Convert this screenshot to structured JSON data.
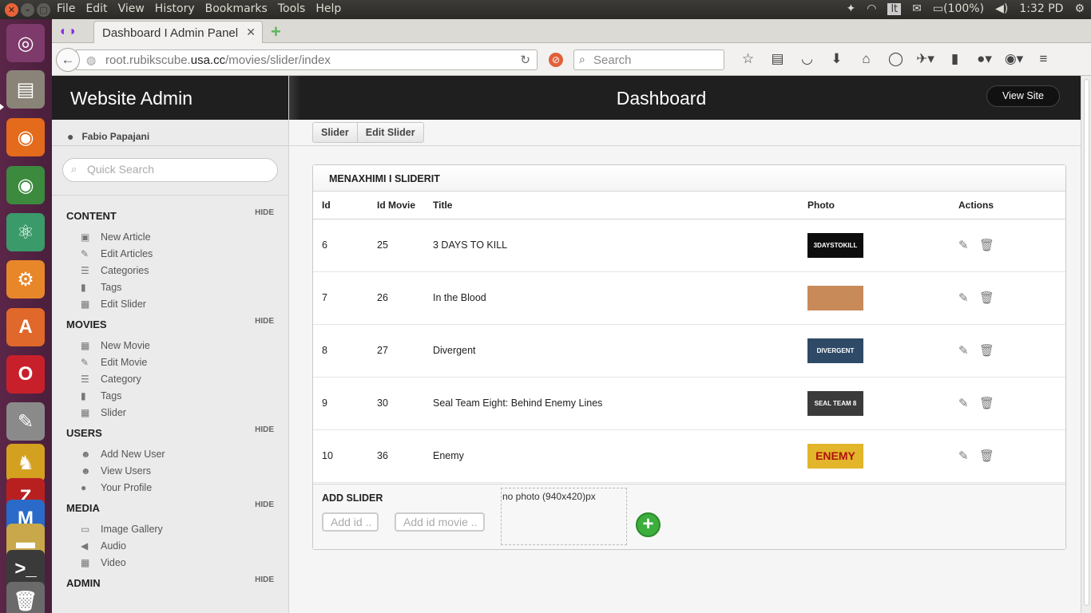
{
  "os": {
    "menus": [
      "File",
      "Edit",
      "View",
      "History",
      "Bookmarks",
      "Tools",
      "Help"
    ],
    "tray": {
      "keyboard": "lt",
      "battery": "(100%)",
      "time": "1:32 PD"
    }
  },
  "browser": {
    "tab_title": "Dashboard I Admin Panel",
    "url_prefix": "root.rubikscube.",
    "url_host": "usa.cc",
    "url_path": "/movies/slider/index",
    "search_placeholder": "Search"
  },
  "sidebar": {
    "site_title": "Website Admin",
    "user": "Fabio Papajani",
    "quick_search_placeholder": "Quick Search",
    "hide_label": "HIDE",
    "sections": [
      {
        "title": "CONTENT",
        "items": [
          {
            "label": "New Article",
            "icon": "new-article-icon"
          },
          {
            "label": "Edit Articles",
            "icon": "pencil-icon"
          },
          {
            "label": "Categories",
            "icon": "list-icon"
          },
          {
            "label": "Tags",
            "icon": "bookmark-icon"
          },
          {
            "label": "Edit Slider",
            "icon": "film-icon"
          }
        ]
      },
      {
        "title": "MOVIES",
        "items": [
          {
            "label": "New Movie",
            "icon": "film-icon"
          },
          {
            "label": "Edit Movie",
            "icon": "pencil-icon"
          },
          {
            "label": "Category",
            "icon": "list-icon"
          },
          {
            "label": "Tags",
            "icon": "bookmark-icon"
          },
          {
            "label": "Slider",
            "icon": "film-icon"
          }
        ]
      },
      {
        "title": "USERS",
        "items": [
          {
            "label": "Add New User",
            "icon": "add-user-icon"
          },
          {
            "label": "View Users",
            "icon": "users-icon"
          },
          {
            "label": "Your Profile",
            "icon": "user-icon"
          }
        ]
      },
      {
        "title": "MEDIA",
        "items": [
          {
            "label": "Image Gallery",
            "icon": "briefcase-icon"
          },
          {
            "label": "Audio",
            "icon": "speaker-icon"
          },
          {
            "label": "Video",
            "icon": "film-icon"
          }
        ]
      },
      {
        "title": "ADMIN",
        "items": []
      }
    ]
  },
  "main": {
    "title": "Dashboard",
    "view_site": "View Site",
    "breadcrumb": [
      "Slider",
      "Edit Slider"
    ],
    "panel_title": "MENAXHIMI I SLIDERIT",
    "columns": [
      "Id",
      "Id Movie",
      "Title",
      "Photo",
      "Actions"
    ],
    "rows": [
      {
        "id": "6",
        "id_movie": "25",
        "title": "3 DAYS TO KILL",
        "thumb_text": "3DAYSTOKILL",
        "thumb_bg": "#0d0d0d"
      },
      {
        "id": "7",
        "id_movie": "26",
        "title": "In the Blood",
        "thumb_text": "",
        "thumb_bg": "#c98a5a"
      },
      {
        "id": "8",
        "id_movie": "27",
        "title": "Divergent",
        "thumb_text": "DIVERGENT",
        "thumb_bg": "#2e4a66"
      },
      {
        "id": "9",
        "id_movie": "30",
        "title": "Seal Team Eight: Behind Enemy Lines",
        "thumb_text": "SEAL TEAM 8",
        "thumb_bg": "#3b3b3b"
      },
      {
        "id": "10",
        "id_movie": "36",
        "title": "Enemy",
        "thumb_text": "ENEMY",
        "thumb_bg": "#e2b52a"
      }
    ],
    "add": {
      "title": "ADD SLIDER",
      "id_placeholder": "Add id ..",
      "id_movie_placeholder": "Add id movie ..",
      "photo_label": "no photo (940x420)px"
    }
  }
}
